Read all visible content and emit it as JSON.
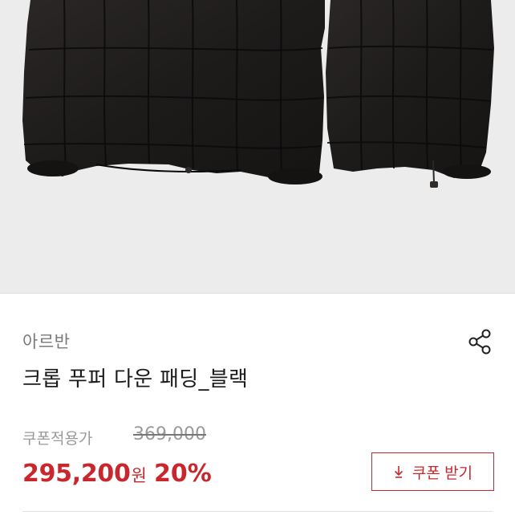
{
  "product": {
    "brand": "아르반",
    "title": "크롭 푸퍼 다운 패딩_블랙"
  },
  "price": {
    "coupon_label": "쿠폰적용가",
    "original": "369,000",
    "sale_amount": "295,200",
    "sale_unit": "원",
    "discount": "20%"
  },
  "actions": {
    "coupon_button_label": "쿠폰 받기"
  },
  "icons": {
    "share": "share-icon",
    "download": "download-arrow-icon"
  },
  "colors": {
    "accent": "#c8282d",
    "hero_background": "#ececec",
    "jacket": "#1c1a19"
  }
}
